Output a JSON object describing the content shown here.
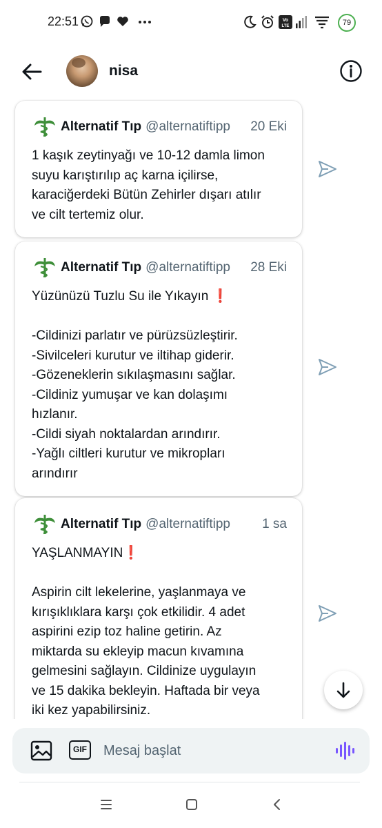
{
  "status_bar": {
    "time": "22:51",
    "icons": [
      "whatsapp-icon",
      "chat-bubble-icon",
      "heart-icon",
      "more-dots-icon",
      "moon-icon",
      "alarm-icon",
      "volte-icon",
      "signal-icon",
      "wifi-icon",
      "battery-icon"
    ],
    "volte_label": "Vo LTE",
    "battery_level": "79"
  },
  "header": {
    "name": "nisa",
    "back_icon": "arrow-left-icon",
    "info_icon": "info-icon"
  },
  "messages": [
    {
      "author": "Alternatif Tıp",
      "handle": "@alternatiftipp",
      "time": "20 Eki",
      "lines": [
        "1 kaşık zeytinyağı ve 10-12 damla limon",
        "suyu karıştırılıp aç karna içilirse,",
        "karaciğerdeki Bütün Zehirler dışarı atılır",
        "ve cilt tertemiz olur."
      ]
    },
    {
      "author": "Alternatif Tıp",
      "handle": "@alternatiftipp",
      "time": "28 Eki",
      "lines": [
        "Yüzünüzü Tuzlu Su ile Yıkayın ",
        "",
        "-Cildinizi parlatır ve pürüzsüzleştirir.",
        "-Sivilceleri kurutur ve iltihap giderir.",
        "-Gözeneklerin sıkılaşmasını sağlar.",
        "-Cildiniz yumuşar ve kan dolaşımı",
        "hızlanır.",
        "-Cildi siyah noktalardan arındırır.",
        "-Yağlı ciltleri kurutur ve mikropları",
        "arındırır"
      ]
    },
    {
      "author": "Alternatif Tıp",
      "handle": "@alternatiftipp",
      "time": "1 sa",
      "lines": [
        "YAŞLANMAYIN",
        "",
        "Aspirin cilt lekelerine, yaşlanmaya ve",
        "kırışıklıklara karşı çok etkilidir. 4 adet",
        "aspirini ezip toz haline getirin. Az",
        "miktarda su ekleyip macun kıvamına",
        "gelmesini sağlayın. Cildinize uygulayın",
        "ve 15 dakika bekleyin. Haftada bir veya",
        "iki kez yapabilirsiniz."
      ]
    }
  ],
  "exclamation_mark": "❗",
  "composer": {
    "placeholder": "Mesaj başlat",
    "gif_label": "GIF"
  },
  "colors": {
    "accent": "#1d9bf0",
    "voice_accent": "#7856ff",
    "exclamation": "#dd2e44",
    "logo_green": "#3f8f3a",
    "share_icon": "#7f9fb5",
    "secondary_text": "#536471",
    "composer_bg": "#eff3f4"
  },
  "nav_bar": [
    "menu-icon",
    "home-square-icon",
    "back-chevron-icon"
  ]
}
